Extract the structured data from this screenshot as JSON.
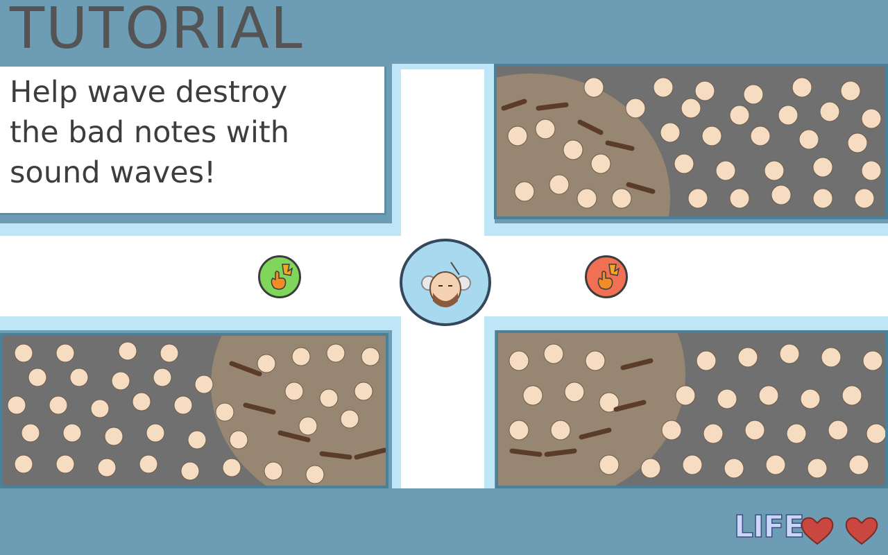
{
  "tutorial": {
    "title": "TUTORIAL",
    "instruction_lines": [
      "Help wave destroy",
      "the bad notes with",
      "sound waves!"
    ]
  },
  "hud": {
    "life_label": "LIFE",
    "hearts": 2
  },
  "controls": {
    "left_button_icon": "tap-finger-icon",
    "right_button_icon": "tap-finger-icon"
  },
  "fields": [
    "top-right",
    "bottom-left",
    "bottom-right"
  ],
  "colors": {
    "background": "#6c9db4",
    "road": "#ffffff",
    "road_edge": "#bfe6f7",
    "field": "#6f6f6f",
    "green_button": "#7fd65a",
    "red_button": "#ef7052",
    "heart": "#c9473f"
  }
}
